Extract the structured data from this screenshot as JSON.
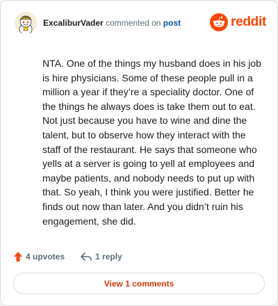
{
  "comment": {
    "username": "ExcaliburVader",
    "action_text": "commented on",
    "post_link": "post",
    "body": "NTA. One of the things my husband does in his job is hire physicians. Some of these people pull in a million a year if they’re a speciality doctor. One of the things he always does is take them out to eat. Not just because you have to wine and dine the talent, but to observe how they interact with the staff of the restaurant. He says that someone who yells at a server is going to yell at employees and maybe patients, and nobody needs to put up with that. So yeah, I think you were justified. Better he finds out now than later. And you didn’t ruin his engagement, she did."
  },
  "brand": {
    "wordmark": "reddit",
    "color": "#ff4500"
  },
  "actions": {
    "upvotes": "4 upvotes",
    "replies": "1 reply",
    "upvote_color": "#ff4500"
  },
  "view_comments": {
    "label": "View 1 comments",
    "color": "#d93a00"
  },
  "icons": {
    "avatar": "snoo-avatar-icon",
    "brand": "reddit-snoo-icon",
    "upvote": "upvote-arrow-icon",
    "reply": "reply-arrow-icon"
  }
}
